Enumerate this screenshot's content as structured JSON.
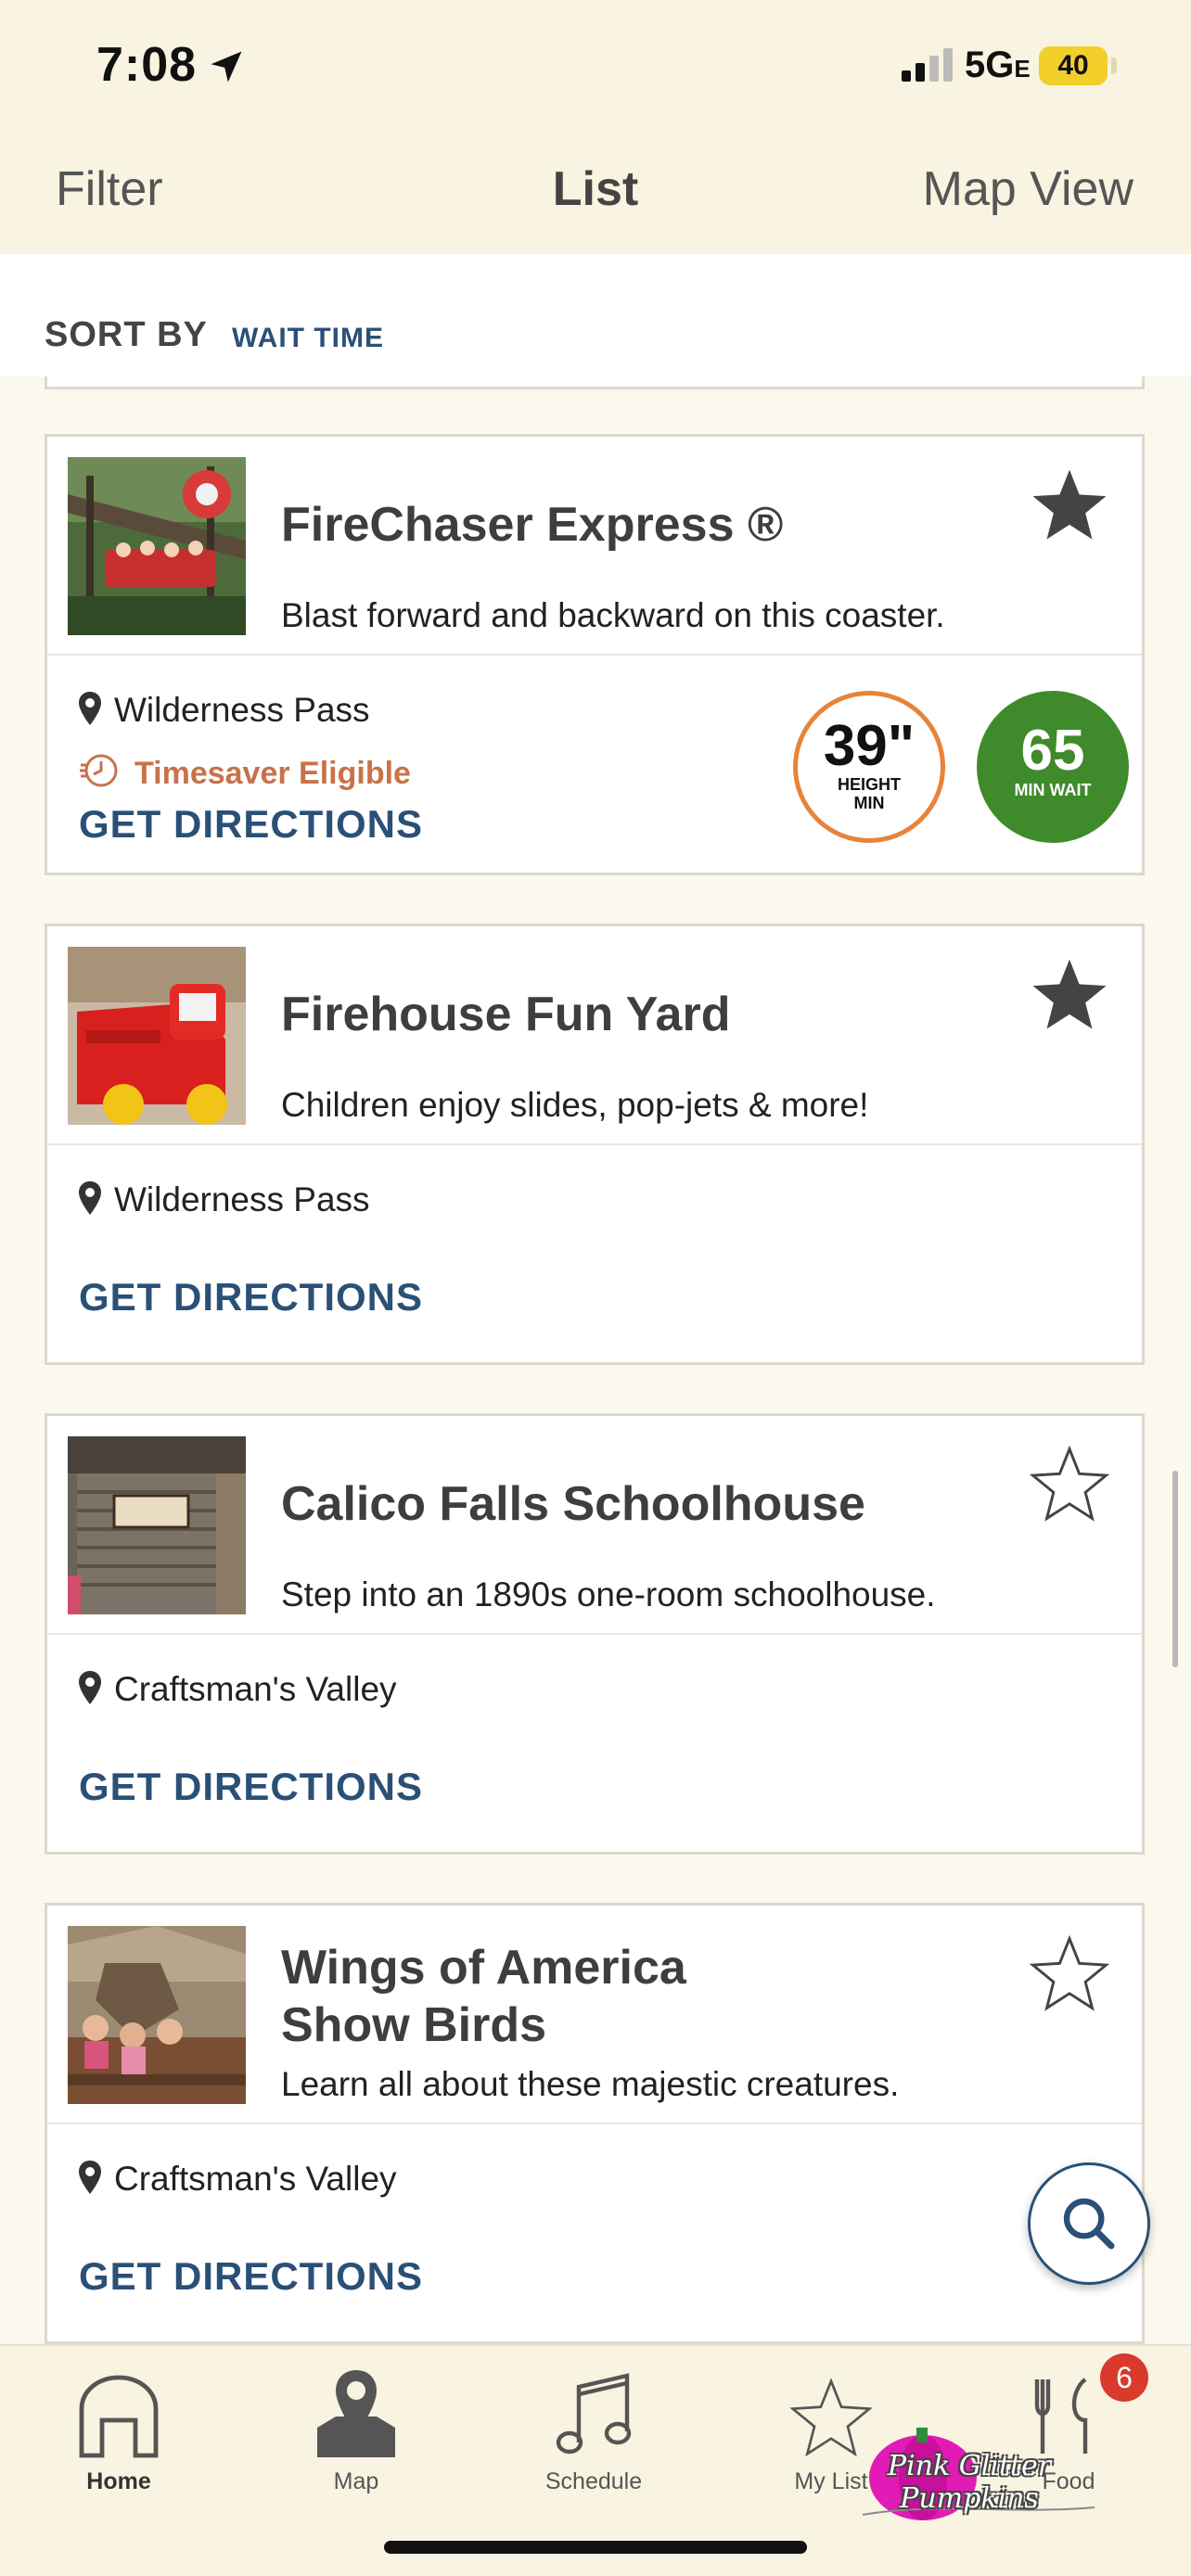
{
  "status_bar": {
    "time": "7:08",
    "network": "5G",
    "network_suffix": "E",
    "battery": "40"
  },
  "topnav": {
    "filter": "Filter",
    "title": "List",
    "map_view": "Map View"
  },
  "sort": {
    "label": "SORT BY",
    "value": "WAIT TIME"
  },
  "cards": [
    {
      "title": "FireChaser Express ®",
      "description": "Blast forward and backward on this coaster.",
      "location": "Wilderness Pass",
      "timesaver": "Timesaver Eligible",
      "directions": "GET DIRECTIONS",
      "height": {
        "value": "39\"",
        "label1": "HEIGHT",
        "label2": "MIN"
      },
      "wait": {
        "value": "65",
        "label": "MIN WAIT"
      },
      "favorite": true,
      "image": "roller-coaster-photo"
    },
    {
      "title": "Firehouse Fun Yard",
      "description": "Children enjoy slides, pop-jets & more!",
      "location": "Wilderness Pass",
      "directions": "GET DIRECTIONS",
      "favorite": true,
      "image": "red-fire-truck-photo"
    },
    {
      "title": "Calico Falls Schoolhouse",
      "description": "Step into an 1890s one-room schoolhouse.",
      "location": "Craftsman's Valley",
      "directions": "GET DIRECTIONS",
      "favorite": false,
      "image": "wooden-schoolhouse-photo"
    },
    {
      "title_line1": "Wings of America",
      "title_line2": "Show Birds",
      "description": "Learn all about these majestic creatures.",
      "location": "Craftsman's Valley",
      "directions": "GET DIRECTIONS",
      "favorite": false,
      "image": "bird-show-photo"
    }
  ],
  "tabbar": {
    "home": "Home",
    "map": "Map",
    "schedule": "Schedule",
    "my_list": "My List",
    "food": "Food",
    "food_badge": "6"
  },
  "watermark": "Pink Glitter Pumpkins",
  "colors": {
    "accent_blue": "#2b5077",
    "wait_green": "#3f8a2b",
    "height_orange": "#e8833a",
    "timesaver": "#c8724a",
    "header_bg": "#f8f4e1"
  },
  "icons": [
    "location-arrow-icon",
    "signal-icon",
    "star-filled-icon",
    "star-outline-icon",
    "map-pin-icon",
    "timesaver-clock-icon",
    "search-icon",
    "home-icon",
    "map-icon",
    "music-note-icon",
    "star-tab-icon"
  ]
}
